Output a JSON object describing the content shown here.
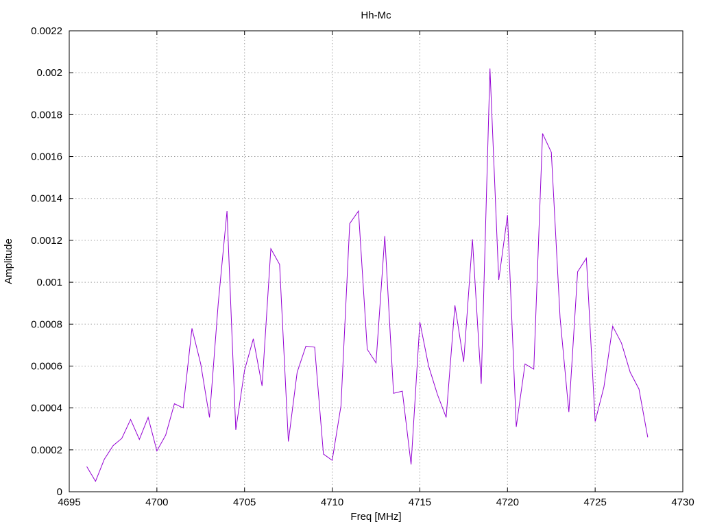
{
  "chart_data": {
    "type": "line",
    "title": "Hh-Mc",
    "xlabel": "Freq [MHz]",
    "ylabel": "Amplitude",
    "xlim": [
      4695,
      4730
    ],
    "ylim": [
      0,
      0.0022
    ],
    "x_ticks": [
      "4695",
      "4700",
      "4705",
      "4710",
      "4715",
      "4720",
      "4725",
      "4730"
    ],
    "y_ticks": [
      "0",
      "0.0002",
      "0.0004",
      "0.0006",
      "0.0008",
      "0.001",
      "0.0012",
      "0.0014",
      "0.0016",
      "0.0018",
      "0.002",
      "0.0022"
    ],
    "grid": true,
    "series_color": "#9400d3",
    "x": [
      4696.0,
      4696.5,
      4697.0,
      4697.5,
      4698.0,
      4698.5,
      4699.0,
      4699.5,
      4700.0,
      4700.5,
      4701.0,
      4701.5,
      4702.0,
      4702.5,
      4703.0,
      4703.5,
      4704.0,
      4704.5,
      4705.0,
      4705.5,
      4706.0,
      4706.5,
      4707.0,
      4707.5,
      4708.0,
      4708.5,
      4709.0,
      4709.5,
      4710.0,
      4710.5,
      4711.0,
      4711.5,
      4712.0,
      4712.5,
      4713.0,
      4713.5,
      4714.0,
      4714.5,
      4715.0,
      4715.5,
      4716.0,
      4716.5,
      4717.0,
      4717.5,
      4718.0,
      4718.5,
      4719.0,
      4719.5,
      4720.0,
      4720.5,
      4721.0,
      4721.5,
      4722.0,
      4722.5,
      4723.0,
      4723.5,
      4724.0,
      4724.5,
      4725.0,
      4725.5,
      4726.0,
      4726.5,
      4727.0,
      4727.5,
      4728.0
    ],
    "y": [
      0.00012,
      5e-05,
      0.000155,
      0.00022,
      0.000255,
      0.000345,
      0.00025,
      0.000355,
      0.000195,
      0.00027,
      0.00042,
      0.0004,
      0.00078,
      0.00061,
      0.000355,
      0.0009,
      0.00134,
      0.000295,
      0.00058,
      0.00073,
      0.000505,
      0.00116,
      0.001085,
      0.00024,
      0.00057,
      0.000695,
      0.00069,
      0.00018,
      0.00015,
      0.00041,
      0.00128,
      0.00134,
      0.00068,
      0.000615,
      0.00122,
      0.00047,
      0.00048,
      0.00013,
      0.00081,
      0.0006,
      0.000465,
      0.000355,
      0.00089,
      0.00062,
      0.001205,
      0.000515,
      0.00202,
      0.00101,
      0.00132,
      0.00031,
      0.00061,
      0.000585,
      0.00171,
      0.00162,
      0.00083,
      0.00038,
      0.00105,
      0.001115,
      0.000335,
      0.0005,
      0.00079,
      0.00071,
      0.00057,
      0.00049,
      0.00026
    ]
  }
}
